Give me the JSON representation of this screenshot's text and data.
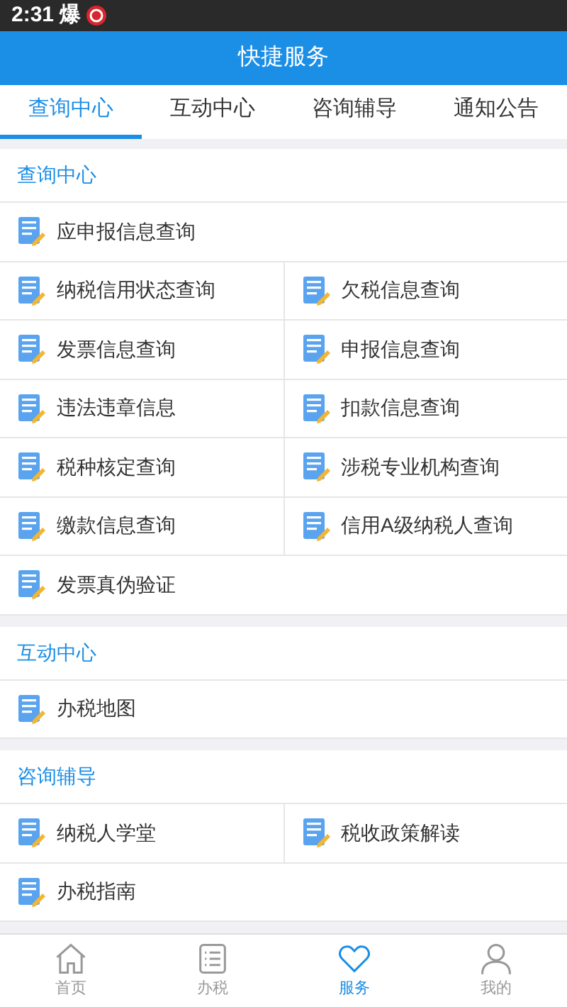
{
  "status_bar": {
    "time": "2:31",
    "glyph": "爆"
  },
  "header": {
    "title": "快捷服务"
  },
  "tabs": [
    {
      "label": "查询中心",
      "selected": true
    },
    {
      "label": "互动中心",
      "selected": false
    },
    {
      "label": "咨询辅导",
      "selected": false
    },
    {
      "label": "通知公告",
      "selected": false
    }
  ],
  "sections": [
    {
      "title": "查询中心",
      "rows": [
        {
          "items": [
            "应申报信息查询"
          ]
        },
        {
          "items": [
            "纳税信用状态查询",
            "欠税信息查询"
          ]
        },
        {
          "items": [
            "发票信息查询",
            "申报信息查询"
          ]
        },
        {
          "items": [
            "违法违章信息",
            "扣款信息查询"
          ]
        },
        {
          "items": [
            "税种核定查询",
            "涉税专业机构查询"
          ]
        },
        {
          "items": [
            "缴款信息查询",
            "信用A级纳税人查询"
          ]
        },
        {
          "items": [
            "发票真伪验证"
          ]
        }
      ]
    },
    {
      "title": "互动中心",
      "rows": [
        {
          "items": [
            "办税地图"
          ]
        }
      ]
    },
    {
      "title": "咨询辅导",
      "rows": [
        {
          "items": [
            "纳税人学堂",
            "税收政策解读"
          ]
        },
        {
          "items": [
            "办税指南"
          ]
        }
      ]
    }
  ],
  "bottom_nav": [
    {
      "label": "首页",
      "kind": "home",
      "selected": false
    },
    {
      "label": "办税",
      "kind": "list",
      "selected": false
    },
    {
      "label": "服务",
      "kind": "heart",
      "selected": true
    },
    {
      "label": "我的",
      "kind": "person",
      "selected": false
    }
  ]
}
